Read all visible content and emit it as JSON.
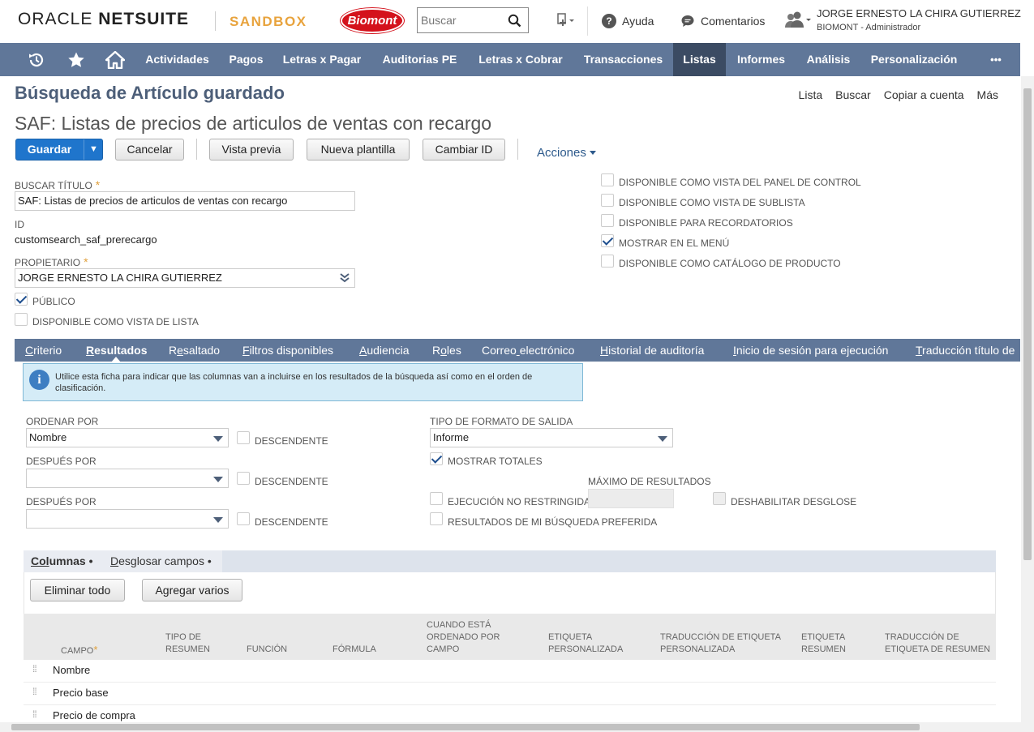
{
  "brand": {
    "oracle": "ORACLE",
    "netsuite": "NETSUITE",
    "sandbox": "SANDBOX",
    "company_logo": "Biomont"
  },
  "header": {
    "search_placeholder": "Buscar",
    "help": "Ayuda",
    "comments": "Comentarios",
    "user_name": "JORGE ERNESTO LA CHIRA GUTIERREZ",
    "user_role": "BIOMONT - Administrador"
  },
  "nav": {
    "items": [
      "Actividades",
      "Pagos",
      "Letras x Pagar",
      "Auditorias PE",
      "Letras x Cobrar",
      "Transacciones",
      "Listas",
      "Informes",
      "Análisis",
      "Personalización"
    ],
    "active": "Listas",
    "more": "•••"
  },
  "page": {
    "title": "Búsqueda de Artículo guardado",
    "subtitle": "SAF: Listas de precios de articulos de ventas con recargo",
    "links": [
      "Lista",
      "Buscar",
      "Copiar a cuenta",
      "Más"
    ]
  },
  "toolbar": {
    "save": "Guardar",
    "save_arrow": "▼",
    "cancel": "Cancelar",
    "preview": "Vista previa",
    "new_template": "Nueva plantilla",
    "change_id": "Cambiar ID",
    "actions": "Acciones"
  },
  "form": {
    "title_label": "BUSCAR TÍTULO",
    "required_mark": "*",
    "title_value": "SAF: Listas de precios de articulos de ventas con recargo",
    "id_label": "ID",
    "id_value": "customsearch_saf_prerecargo",
    "owner_label": "PROPIETARIO",
    "owner_value": "JORGE ERNESTO LA CHIRA GUTIERREZ",
    "public_label": "PÚBLICO",
    "public_checked": true,
    "list_view_label": "DISPONIBLE COMO VISTA DE LISTA",
    "list_view_checked": false,
    "right_checkboxes": [
      {
        "label": "DISPONIBLE COMO VISTA DEL PANEL DE CONTROL",
        "checked": false
      },
      {
        "label": "DISPONIBLE COMO VISTA DE SUBLISTA",
        "checked": false
      },
      {
        "label": "DISPONIBLE PARA RECORDATORIOS",
        "checked": false
      },
      {
        "label": "MOSTRAR EN EL MENÚ",
        "checked": true
      },
      {
        "label": "DISPONIBLE COMO CATÁLOGO DE PRODUCTO",
        "checked": false
      }
    ]
  },
  "subtabs": {
    "items": [
      {
        "u": "C",
        "rest": "riterio"
      },
      {
        "u": "R",
        "rest": "esultados"
      },
      {
        "pre": "R",
        "u": "e",
        "rest": "saltado"
      },
      {
        "u": "F",
        "rest": "iltros disponibles"
      },
      {
        "u": "A",
        "rest": "udiencia"
      },
      {
        "pre": "R",
        "u": "o",
        "rest": "les"
      },
      {
        "pre": "Correo",
        "u": " ",
        "rest": "electrónico"
      },
      {
        "u": "H",
        "rest": "istorial de auditoría"
      },
      {
        "u": "I",
        "rest": "nicio de sesión para ejecución"
      },
      {
        "u": "T",
        "rest": "raducción título de"
      }
    ],
    "active": "Resultados"
  },
  "info": {
    "icon": "i",
    "text": "Utilice esta ficha para indicar que las columnas van a incluirse en los resultados de la búsqueda así como en el orden de clasificación."
  },
  "results": {
    "sort_by_label": "ORDENAR POR",
    "sort_by_value": "Nombre",
    "then_by_label": "DESPUÉS POR",
    "then_by_value": "",
    "then_by2_label": "DESPUÉS POR",
    "then_by2_value": "",
    "descending_label": "DESCENDENTE",
    "output_type_label": "TIPO DE FORMATO DE SALIDA",
    "output_type_value": "Informe",
    "show_totals_label": "MOSTRAR TOTALES",
    "show_totals_checked": true,
    "max_results_label": "MÁXIMO DE RESULTADOS",
    "unrestricted_label": "EJECUCIÓN NO RESTRINGIDA",
    "disable_drilldown_label": "DESHABILITAR DESGLOSE",
    "preferred_label": "RESULTADOS DE MI BÚSQUEDA PREFERIDA"
  },
  "inner_tabs": {
    "columns_u": "Col",
    "columns_rest": "umnas",
    "drilldown_u": "D",
    "drilldown_rest": "esglosar campos",
    "dot": "•"
  },
  "grid": {
    "remove_all": "Eliminar todo",
    "add_multiple": "Agregar varios",
    "headers": {
      "field": "CAMPO",
      "summary_type": "TIPO DE RESUMEN",
      "function": "FUNCIÓN",
      "formula": "FÓRMULA",
      "when_sorted": "CUANDO ESTÁ ORDENADO POR CAMPO",
      "custom_label": "ETIQUETA PERSONALIZADA",
      "custom_label_translation": "TRADUCCIÓN DE ETIQUETA PERSONALIZADA",
      "summary_label": "ETIQUETA RESUMEN",
      "summary_label_translation": "TRADUCCIÓN DE ETIQUETA DE RESUMEN"
    },
    "rows": [
      "Nombre",
      "Precio base",
      "Precio de compra"
    ]
  },
  "colors": {
    "nav": "#607799",
    "nav_active": "#3b4b63",
    "primary": "#1f75cc",
    "title": "#4d5f79",
    "required": "#e0a03c"
  }
}
